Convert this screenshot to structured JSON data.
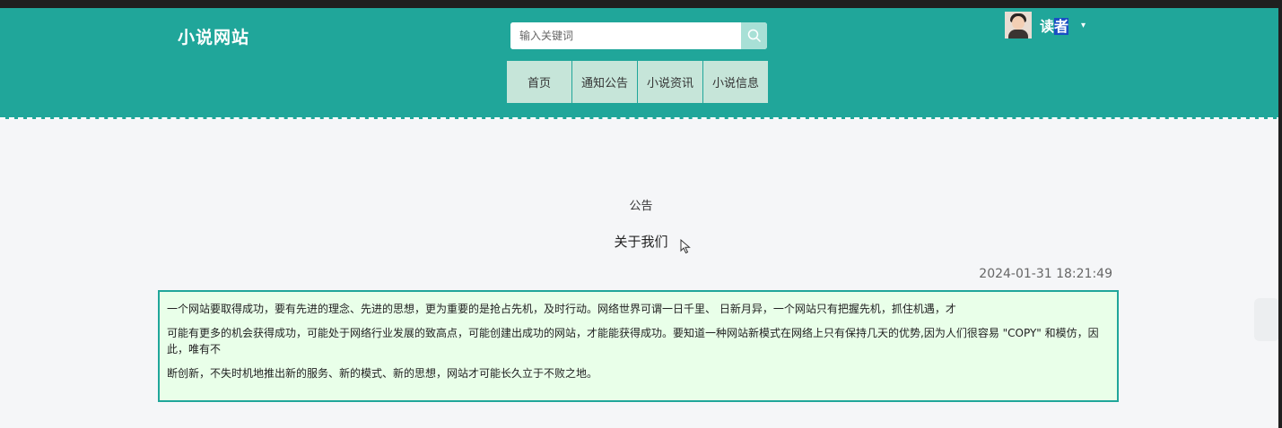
{
  "header": {
    "logo": "小说网站",
    "search": {
      "placeholder": "输入关键词"
    },
    "nav": [
      "首页",
      "通知公告",
      "小说资讯",
      "小说信息"
    ],
    "user": {
      "name_part1": "读",
      "name_part2": "者"
    }
  },
  "article": {
    "category": "公告",
    "title": "关于我们",
    "datetime": "2024-01-31 18:21:49",
    "paragraphs": [
      "一个网站要取得成功，要有先进的理念、先进的思想，更为重要的是抢占先机，及时行动。网络世界可谓一日千里、 日新月异，一个网站只有把握先机，抓住机遇，才",
      "可能有更多的机会获得成功，可能处于网络行业发展的致高点，可能创建出成功的网站，才能能获得成功。要知道一种网站新模式在网络上只有保持几天的优势,因为人们很容易 \"COPY\" 和模仿，因此，唯有不",
      "断创新，不失时机地推出新的服务、新的模式、新的思想，网站才可能长久立于不败之地。"
    ]
  },
  "colors": {
    "header_bg": "#20a69a",
    "nav_item_bg": "#c6e5d9",
    "content_bg": "#e9ffe9",
    "content_border": "#20a69a"
  },
  "icons": {
    "search": "search-icon",
    "dropdown": "caret-down-icon",
    "cursor": "mouse-pointer-icon"
  }
}
